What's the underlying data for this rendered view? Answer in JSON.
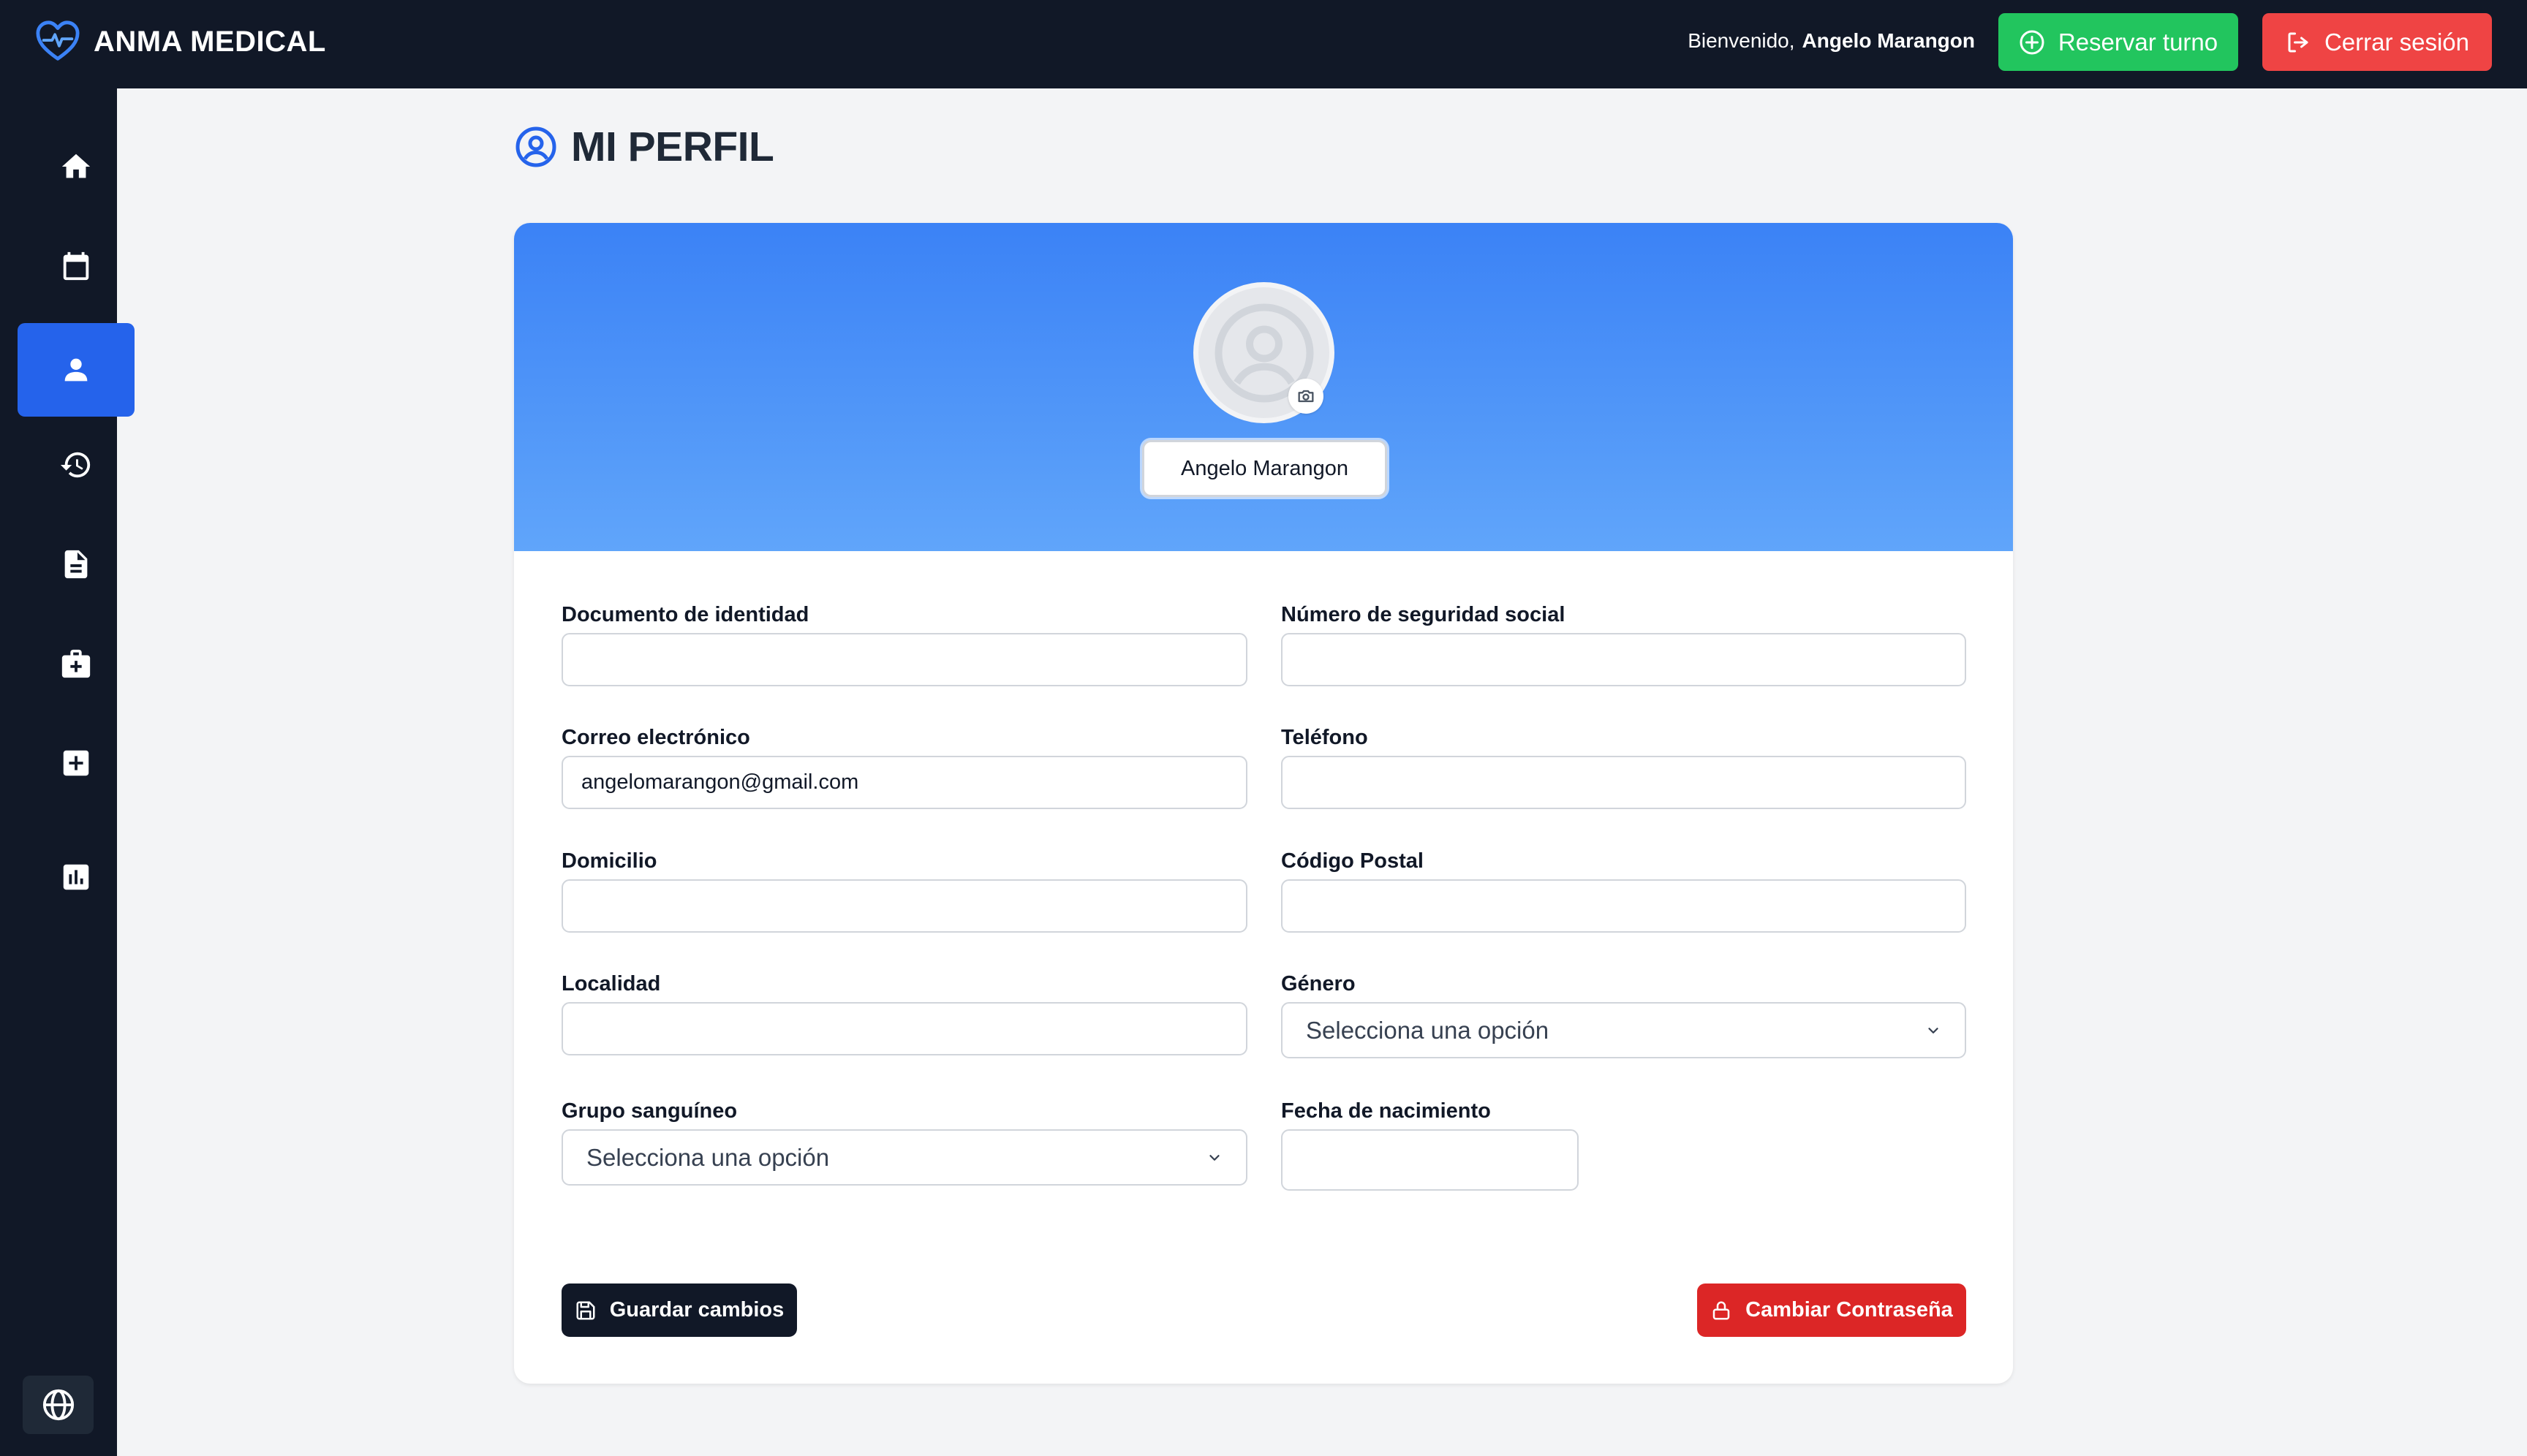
{
  "app": {
    "brand": "ANMA MEDICAL",
    "welcome_prefix": "Bienvenido,",
    "user_name": "Angelo Marangon",
    "reserve_label": "Reservar turno",
    "logout_label": "Cerrar sesión"
  },
  "sidebar": {
    "items": [
      {
        "icon": "home-icon",
        "active": false
      },
      {
        "icon": "calendar-icon",
        "active": false
      },
      {
        "icon": "user-icon",
        "active": true
      },
      {
        "icon": "history-icon",
        "active": false
      },
      {
        "icon": "document-icon",
        "active": false
      },
      {
        "icon": "medical-kit-icon",
        "active": false
      },
      {
        "icon": "medical-cross-icon",
        "active": false
      },
      {
        "icon": "chart-icon",
        "active": false
      }
    ],
    "bottom_icon": "globe-icon"
  },
  "page": {
    "title": "MI PERFIL"
  },
  "profile": {
    "display_name": "Angelo Marangon"
  },
  "form": {
    "documento": {
      "label": "Documento de identidad",
      "value": ""
    },
    "seguridad": {
      "label": "Número de seguridad social",
      "value": ""
    },
    "correo": {
      "label": "Correo electrónico",
      "value": "angelomarangon@gmail.com"
    },
    "telefono": {
      "label": "Teléfono",
      "value": ""
    },
    "domicilio": {
      "label": "Domicilio",
      "value": ""
    },
    "postal": {
      "label": "Código Postal",
      "value": ""
    },
    "localidad": {
      "label": "Localidad",
      "value": ""
    },
    "genero": {
      "label": "Género",
      "value": "Selecciona una opción"
    },
    "grupo": {
      "label": "Grupo sanguíneo",
      "value": "Selecciona una opción"
    },
    "fecha": {
      "label": "Fecha de nacimiento",
      "value": ""
    }
  },
  "actions": {
    "save_label": "Guardar cambios",
    "password_label": "Cambiar Contraseña"
  },
  "colors": {
    "topbar": "#111827",
    "accent": "#2563eb",
    "success": "#22c55e",
    "danger": "#ef4444",
    "header_gradient_top": "#3b82f6",
    "header_gradient_bottom": "#60a5fa"
  }
}
